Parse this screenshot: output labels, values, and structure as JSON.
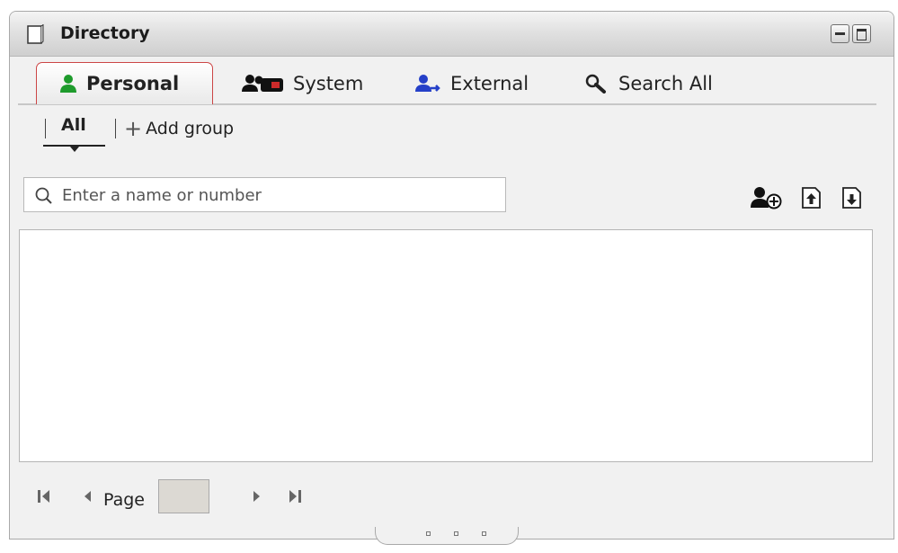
{
  "window": {
    "title": "Directory"
  },
  "tabs": [
    {
      "label": "Personal",
      "icon": "person-green-icon",
      "active": true
    },
    {
      "label": "System",
      "icon": "people-system-icon",
      "active": false
    },
    {
      "label": "External",
      "icon": "person-blue-icon",
      "active": false
    },
    {
      "label": "Search All",
      "icon": "magnifier-icon",
      "active": false
    }
  ],
  "groups": {
    "all_label": "All",
    "add_group_label": "Add group"
  },
  "search": {
    "placeholder": "Enter a name or number",
    "value": ""
  },
  "toolbar": {
    "add_contact_icon": "add-contact-icon",
    "export_icon": "export-icon",
    "import_icon": "import-icon"
  },
  "pagination": {
    "page_label": "Page",
    "page_value": ""
  },
  "colors": {
    "active_tab_border": "#cc4646",
    "personal_icon": "#1e9b2c",
    "external_icon": "#2540c8"
  }
}
